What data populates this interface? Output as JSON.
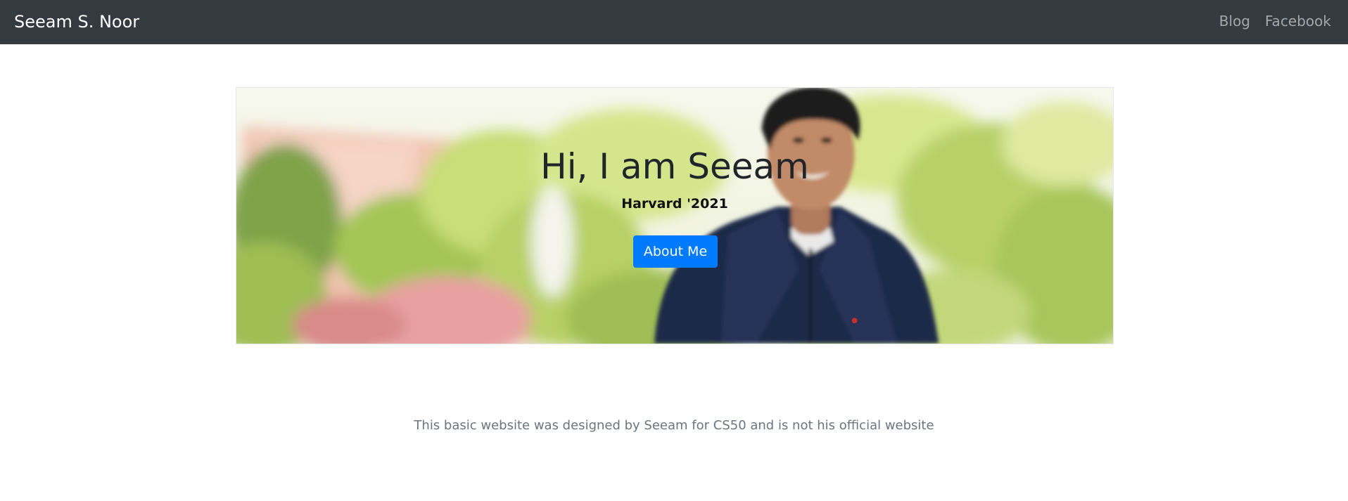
{
  "navbar": {
    "brand": "Seeam S. Noor",
    "links": [
      {
        "label": "Blog"
      },
      {
        "label": "Facebook"
      }
    ],
    "background": "#343a40"
  },
  "hero": {
    "title": "Hi, I am Seeam",
    "subtitle": "Harvard '2021",
    "button_label": "About Me",
    "button_color": "#007bff"
  },
  "footer": {
    "text": "This basic website was designed by Seeam for CS50 and is not his official website"
  }
}
